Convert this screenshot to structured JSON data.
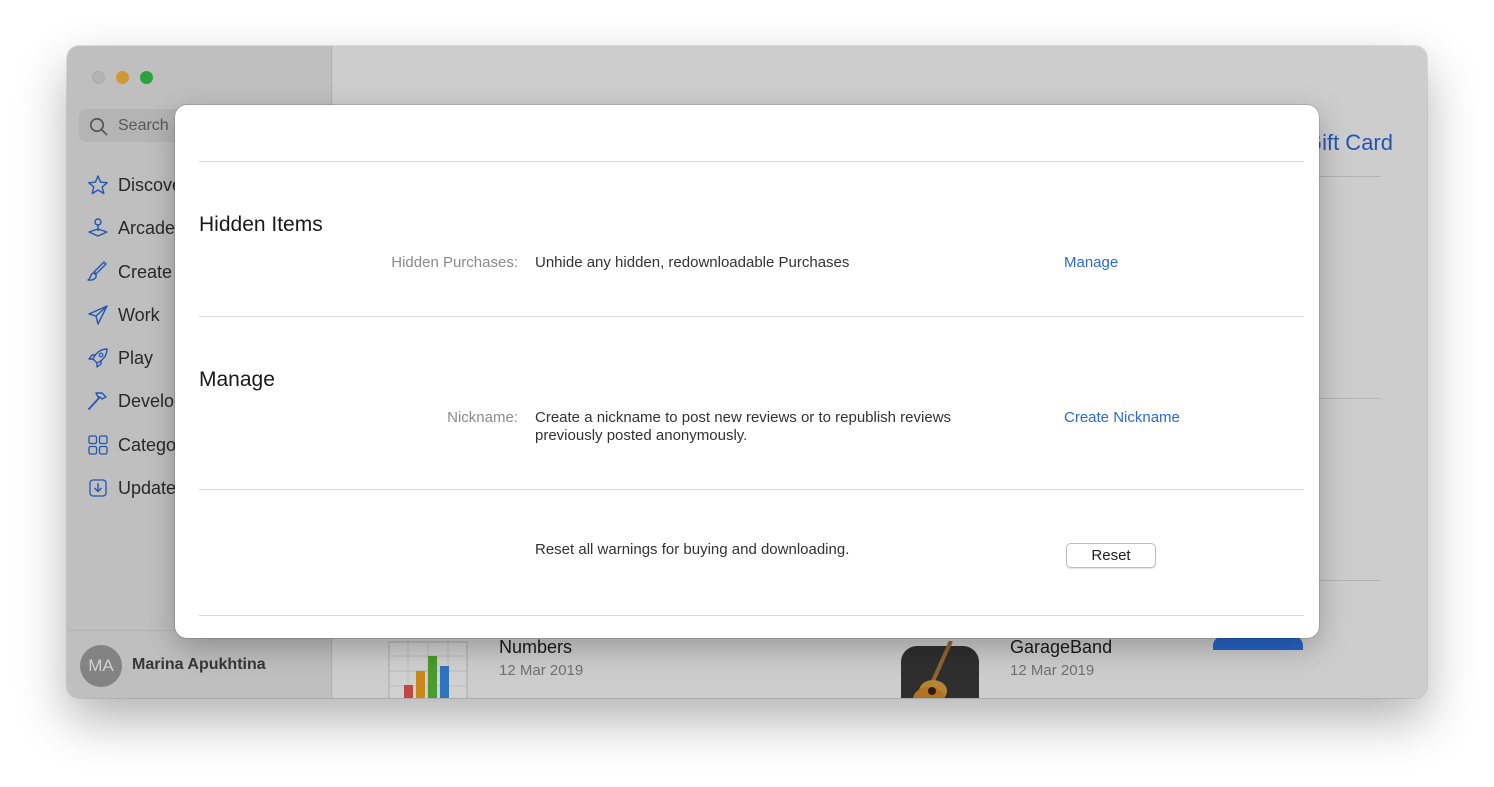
{
  "sidebar": {
    "search_placeholder": "Search",
    "items": [
      {
        "label": "Discover",
        "icon": "star-icon"
      },
      {
        "label": "Arcade",
        "icon": "joystick-icon"
      },
      {
        "label": "Create",
        "icon": "brush-icon"
      },
      {
        "label": "Work",
        "icon": "paper-plane-icon"
      },
      {
        "label": "Play",
        "icon": "rocket-icon"
      },
      {
        "label": "Develop",
        "icon": "hammer-icon"
      },
      {
        "label": "Categories",
        "icon": "grid-icon"
      },
      {
        "label": "Updates",
        "icon": "download-icon"
      }
    ],
    "user": {
      "initials": "MA",
      "name": "Marina Apukhtina"
    }
  },
  "main": {
    "redeem_label": "Redeem Gift Card",
    "apps": [
      {
        "name": "Numbers",
        "date": "12 Mar 2019",
        "icon": "numbers-icon"
      },
      {
        "name": "GarageBand",
        "date": "12 Mar 2019",
        "icon": "garageband-icon"
      }
    ]
  },
  "sheet": {
    "hidden_items": {
      "title": "Hidden Items",
      "label": "Hidden Purchases:",
      "text": "Unhide any hidden, redownloadable Purchases",
      "action": "Manage"
    },
    "manage": {
      "title": "Manage",
      "label": "Nickname:",
      "text": "Create a nickname to post new reviews or to republish reviews previously posted anonymously.",
      "action": "Create Nickname"
    },
    "reset": {
      "text": "Reset all warnings for buying and downloading.",
      "button": "Reset"
    }
  },
  "colors": {
    "accent": "#2a6ad8",
    "close": "#dcdcdc",
    "minimize": "#fdbc40",
    "maximize": "#34c84a"
  }
}
